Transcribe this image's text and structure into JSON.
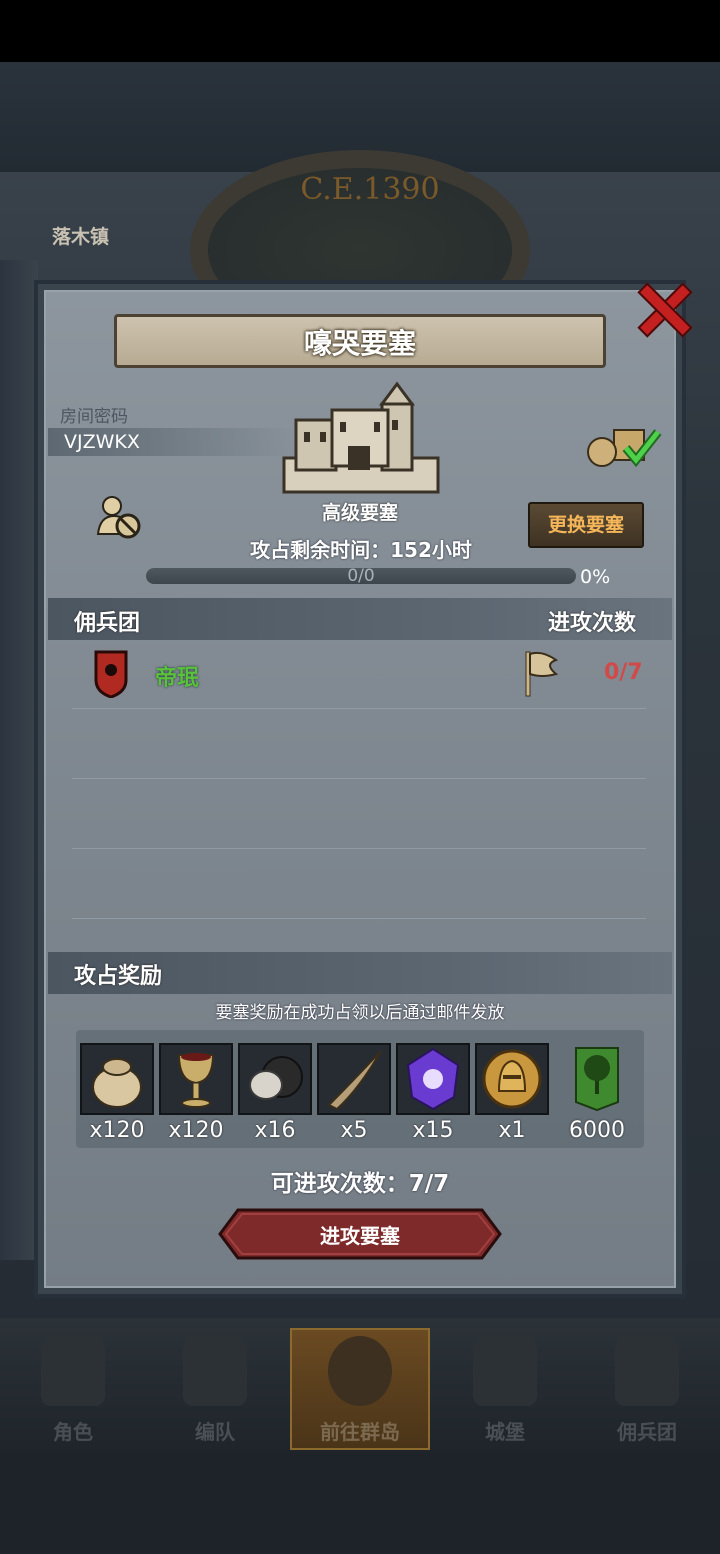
{
  "background": {
    "era_label": "C.E.1390",
    "town_label": "落木镇"
  },
  "dialog": {
    "title": "嚎哭要塞",
    "room_password_label": "房间密码",
    "room_password_value": "VJZWKX",
    "fortress_level": "高级要塞",
    "remaining_time": "攻占剩余时间：152小时",
    "progress_text": "0/0",
    "progress_percent": "0%",
    "progress_fraction": 0,
    "change_button": "更换要塞",
    "mercenary_header": "佣兵团",
    "attack_count_header": "进攻次数",
    "mercenaries": [
      {
        "name": "帝珉",
        "attacks": "0/7"
      }
    ],
    "reward_header": "攻占奖励",
    "reward_note": "要塞奖励在成功占领以后通过邮件发放",
    "rewards": [
      {
        "icon": "grain-sack-icon",
        "qty": "x120"
      },
      {
        "icon": "goblet-icon",
        "qty": "x120"
      },
      {
        "icon": "ore-icon",
        "qty": "x16"
      },
      {
        "icon": "horn-icon",
        "qty": "x5"
      },
      {
        "icon": "purple-crystal-icon",
        "qty": "x15"
      },
      {
        "icon": "knight-helmet-coin-icon",
        "qty": "x1"
      },
      {
        "icon": "tree-banner-icon",
        "qty": "6000"
      }
    ],
    "attempts_text": "可进攻次数：7/7",
    "attack_button": "进攻要塞"
  },
  "nav": {
    "items": [
      {
        "label": "角色"
      },
      {
        "label": "编队"
      },
      {
        "label": "前往群岛"
      },
      {
        "label": "城堡"
      },
      {
        "label": "佣兵团"
      }
    ]
  },
  "colors": {
    "guild_name": "#59c23a",
    "attack_count": "#d14a4a",
    "change_button_text": "#f5b65a",
    "close_x": "#c42020"
  }
}
